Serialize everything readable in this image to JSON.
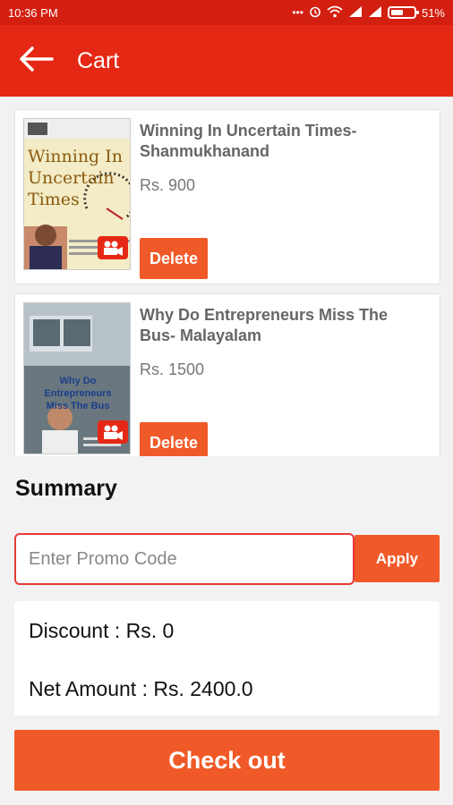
{
  "status_bar": {
    "time": "10:36 PM",
    "icons": [
      "more-dots-icon",
      "alarm-icon",
      "wifi-icon",
      "signal-icon",
      "signal-icon",
      "battery-icon"
    ],
    "battery_text": "51%"
  },
  "app_bar": {
    "title": "Cart",
    "back_icon": "arrow-left-icon"
  },
  "cart": {
    "items": [
      {
        "title": "Winning In Uncertain Times- Shanmukhanand",
        "price": "Rs. 900",
        "delete_label": "Delete",
        "thumbnail": {
          "cover_line1": "Winning In",
          "cover_line2": "Uncertain",
          "cover_line3": "Times",
          "video_icon": "video-camera-icon"
        }
      },
      {
        "title": "Why Do Entrepreneurs Miss The Bus- Malayalam",
        "price": "Rs. 1500",
        "delete_label": "Delete",
        "thumbnail": {
          "cover_line1": "Why Do Entrepreneurs",
          "cover_line2": "Miss The Bus",
          "video_icon": "video-camera-icon"
        }
      }
    ]
  },
  "summary": {
    "title": "Summary",
    "promo_placeholder": "Enter Promo Code",
    "promo_value": "",
    "apply_label": "Apply",
    "discount_text": "Discount : Rs. 0",
    "net_amount_text": "Net Amount : Rs. 2400.0"
  },
  "checkout": {
    "label": "Check out"
  },
  "colors": {
    "status_bar": "#d31f10",
    "app_bar": "#e52814",
    "accent": "#f05a28",
    "promo_border": "#e53935",
    "background": "#f2f2f2"
  }
}
